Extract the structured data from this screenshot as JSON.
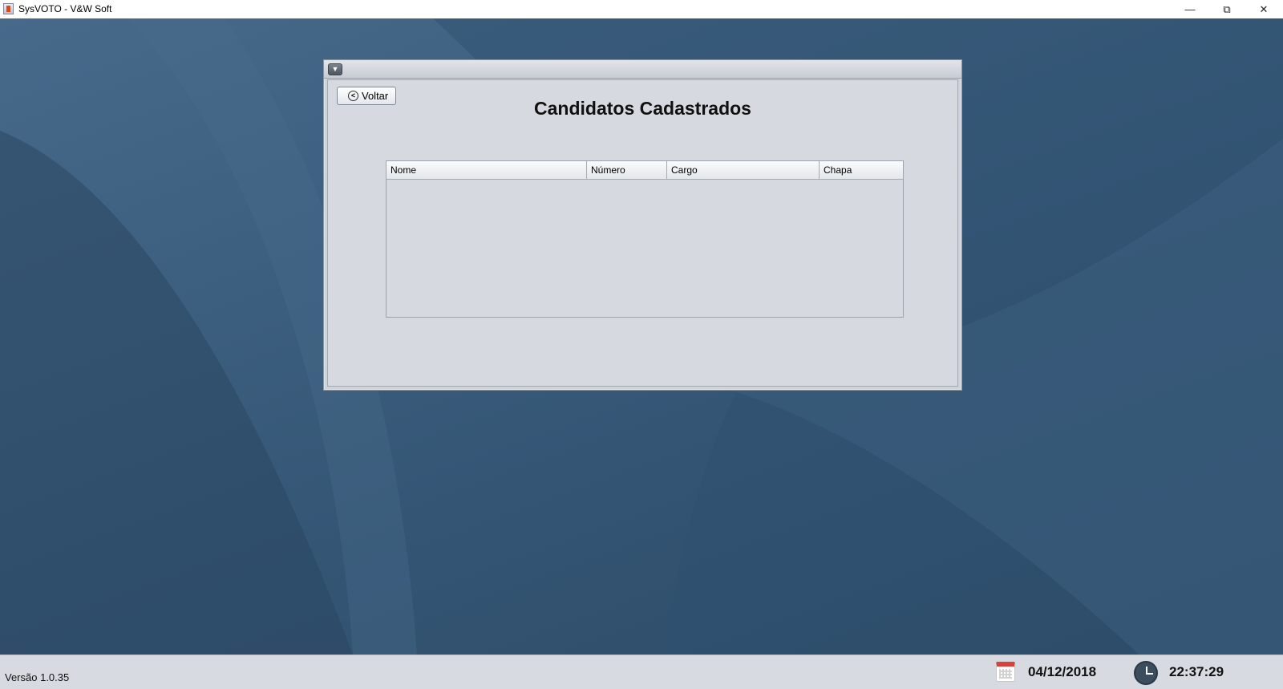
{
  "window": {
    "title": "SysVOTO - V&W Soft",
    "minimize_icon": "minimize-icon",
    "maximize_icon": "restore-icon",
    "close_icon": "close-icon"
  },
  "frame": {
    "menu_icon": "chevron-down-icon",
    "back_label": "Voltar",
    "back_icon": "arrow-left-circle-icon",
    "title": "Candidatos Cadastrados",
    "table": {
      "columns": [
        "Nome",
        "Número",
        "Cargo",
        "Chapa"
      ],
      "rows": []
    }
  },
  "status": {
    "version": "Versão 1.0.35",
    "date": "04/12/2018",
    "time": "22:37:29",
    "calendar_icon": "calendar-icon",
    "clock_icon": "clock-icon"
  },
  "colors": {
    "desktop": "#3c5e7e",
    "frame_bg": "#d6d9df",
    "status_bg": "#d7dae0"
  }
}
